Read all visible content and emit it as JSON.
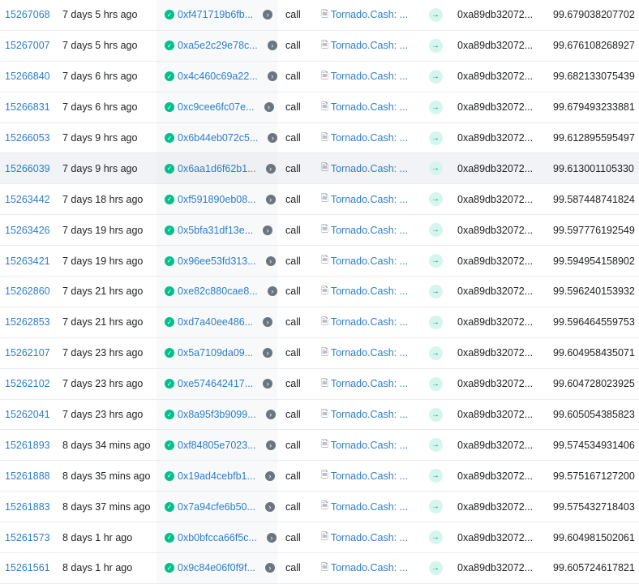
{
  "colors": {
    "link": "#2d7ec9",
    "success": "#00c08b",
    "arrow_bg": "#d6f5ec",
    "arrow": "#00a186"
  },
  "icons": {
    "status": "check-circle-icon",
    "goto": "chevron-right-circle-icon",
    "contract": "contract-doc-icon",
    "direction": "arrow-right-icon"
  },
  "rows": [
    {
      "block": "15267068",
      "age": "7 days 5 hrs ago",
      "parent": "0xf471719b6fb...",
      "type": "call",
      "from": "Tornado.Cash: ...",
      "to": "0xa89db32072...",
      "value": "99.679038207702"
    },
    {
      "block": "15267007",
      "age": "7 days 5 hrs ago",
      "parent": "0xa5e2c29e78c...",
      "type": "call",
      "from": "Tornado.Cash: ...",
      "to": "0xa89db32072...",
      "value": "99.676108268927"
    },
    {
      "block": "15266840",
      "age": "7 days 6 hrs ago",
      "parent": "0x4c460c69a22...",
      "type": "call",
      "from": "Tornado.Cash: ...",
      "to": "0xa89db32072...",
      "value": "99.682133075439"
    },
    {
      "block": "15266831",
      "age": "7 days 6 hrs ago",
      "parent": "0xc9cee6fc07e...",
      "type": "call",
      "from": "Tornado.Cash: ...",
      "to": "0xa89db32072...",
      "value": "99.679493233881"
    },
    {
      "block": "15266053",
      "age": "7 days 9 hrs ago",
      "parent": "0x6b44eb072c5...",
      "type": "call",
      "from": "Tornado.Cash: ...",
      "to": "0xa89db32072...",
      "value": "99.612895595497"
    },
    {
      "block": "15266039",
      "age": "7 days 9 hrs ago",
      "parent": "0x6aa1d6f62b1...",
      "type": "call",
      "from": "Tornado.Cash: ...",
      "to": "0xa89db32072...",
      "value": "99.613001105330"
    },
    {
      "block": "15263442",
      "age": "7 days 18 hrs ago",
      "parent": "0xf591890eb08...",
      "type": "call",
      "from": "Tornado.Cash: ...",
      "to": "0xa89db32072...",
      "value": "99.587448741824"
    },
    {
      "block": "15263426",
      "age": "7 days 19 hrs ago",
      "parent": "0x5bfa31df13e...",
      "type": "call",
      "from": "Tornado.Cash: ...",
      "to": "0xa89db32072...",
      "value": "99.597776192549"
    },
    {
      "block": "15263421",
      "age": "7 days 19 hrs ago",
      "parent": "0x96ee53fd313...",
      "type": "call",
      "from": "Tornado.Cash: ...",
      "to": "0xa89db32072...",
      "value": "99.594954158902"
    },
    {
      "block": "15262860",
      "age": "7 days 21 hrs ago",
      "parent": "0xe82c880cae8...",
      "type": "call",
      "from": "Tornado.Cash: ...",
      "to": "0xa89db32072...",
      "value": "99.596240153932"
    },
    {
      "block": "15262853",
      "age": "7 days 21 hrs ago",
      "parent": "0xd7a40ee486...",
      "type": "call",
      "from": "Tornado.Cash: ...",
      "to": "0xa89db32072...",
      "value": "99.596464559753"
    },
    {
      "block": "15262107",
      "age": "7 days 23 hrs ago",
      "parent": "0x5a7109da09...",
      "type": "call",
      "from": "Tornado.Cash: ...",
      "to": "0xa89db32072...",
      "value": "99.604958435071"
    },
    {
      "block": "15262102",
      "age": "7 days 23 hrs ago",
      "parent": "0xe574642417...",
      "type": "call",
      "from": "Tornado.Cash: ...",
      "to": "0xa89db32072...",
      "value": "99.604728023925"
    },
    {
      "block": "15262041",
      "age": "7 days 23 hrs ago",
      "parent": "0x8a95f3b9099...",
      "type": "call",
      "from": "Tornado.Cash: ...",
      "to": "0xa89db32072...",
      "value": "99.605054385823"
    },
    {
      "block": "15261893",
      "age": "8 days 34 mins ago",
      "parent": "0xf84805e7023...",
      "type": "call",
      "from": "Tornado.Cash: ...",
      "to": "0xa89db32072...",
      "value": "99.574534931406"
    },
    {
      "block": "15261888",
      "age": "8 days 35 mins ago",
      "parent": "0x19ad4cebfb1...",
      "type": "call",
      "from": "Tornado.Cash: ...",
      "to": "0xa89db32072...",
      "value": "99.575167127200"
    },
    {
      "block": "15261883",
      "age": "8 days 37 mins ago",
      "parent": "0x7a94cfe6b50...",
      "type": "call",
      "from": "Tornado.Cash: ...",
      "to": "0xa89db32072...",
      "value": "99.575432718403"
    },
    {
      "block": "15261573",
      "age": "8 days 1 hr ago",
      "parent": "0xb0bfcca66f5c...",
      "type": "call",
      "from": "Tornado.Cash: ...",
      "to": "0xa89db32072...",
      "value": "99.604981502061"
    },
    {
      "block": "15261561",
      "age": "8 days 1 hr ago",
      "parent": "0x9c84e06f0f9f...",
      "type": "call",
      "from": "Tornado.Cash: ...",
      "to": "0xa89db32072...",
      "value": "99.605724617821"
    }
  ]
}
